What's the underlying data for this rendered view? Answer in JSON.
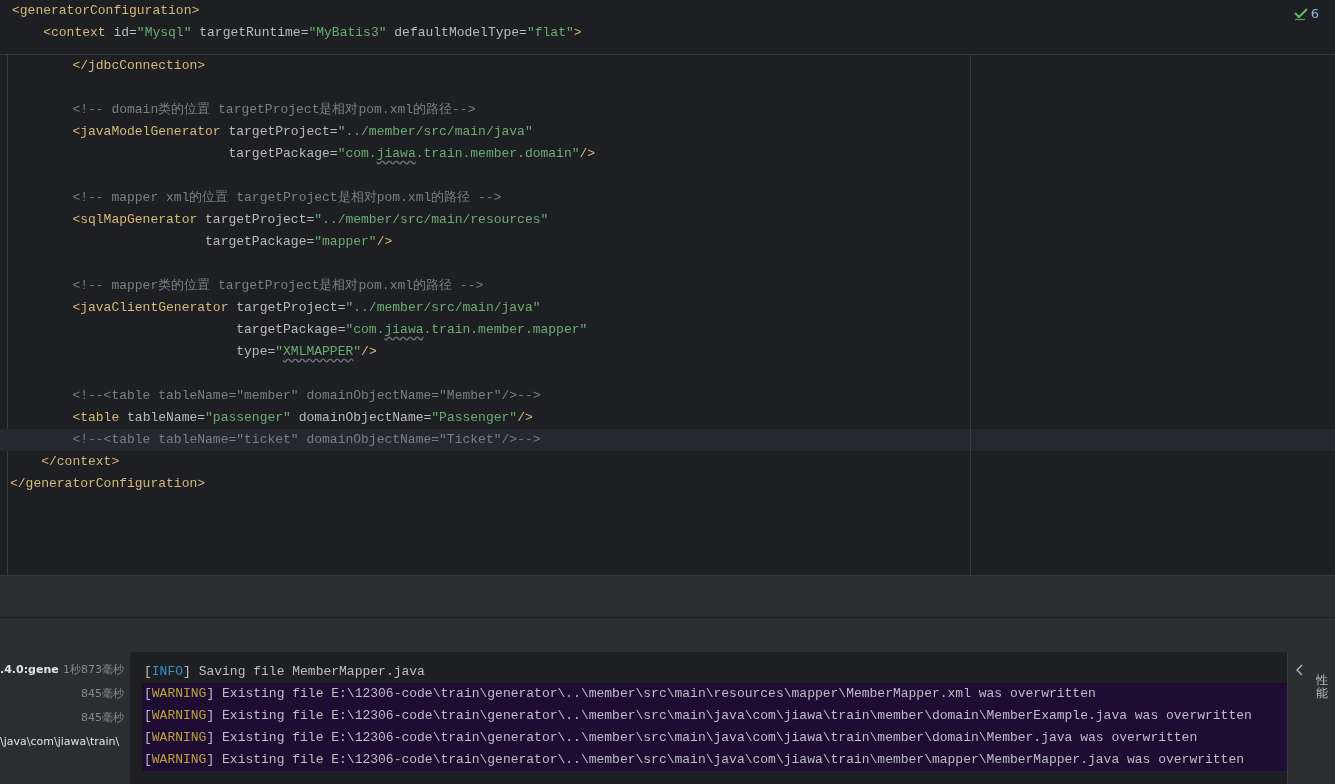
{
  "inspection_widget": {
    "count": "6"
  },
  "sticky_lines": [
    [
      {
        "kind": "tag",
        "text": "<generatorConfiguration>"
      }
    ],
    [
      {
        "kind": "tag",
        "text": "    <context "
      },
      {
        "kind": "attr",
        "text": "id="
      },
      {
        "kind": "value",
        "text": "\"Mysql\""
      },
      {
        "kind": "attr",
        "text": " targetRuntime="
      },
      {
        "kind": "value",
        "text": "\"MyBatis3\""
      },
      {
        "kind": "attr",
        "text": " defaultModelType="
      },
      {
        "kind": "value",
        "text": "\"flat\""
      },
      {
        "kind": "tag",
        "text": ">"
      }
    ]
  ],
  "code_lines": [
    {
      "current": false,
      "segments": [
        {
          "kind": "tag",
          "text": "        </jdbcConnection>"
        }
      ]
    },
    {
      "current": false
    },
    {
      "current": false,
      "segments": [
        {
          "kind": "comment",
          "text": "        <!-- domain类的位置 targetProject是相对pom.xml的路径-->"
        }
      ]
    },
    {
      "current": false,
      "segments": [
        {
          "kind": "tag",
          "text": "        <javaModelGenerator "
        },
        {
          "kind": "attr",
          "text": "targetProject="
        },
        {
          "kind": "value",
          "text": "\"../member/src/main/java\""
        }
      ]
    },
    {
      "current": false,
      "segments": [
        {
          "kind": "attr",
          "text": "                            targetPackage="
        },
        {
          "kind": "value",
          "text": "\"com."
        },
        {
          "kind": "typo",
          "text": "jiawa"
        },
        {
          "kind": "value",
          "text": ".train.member.domain\""
        },
        {
          "kind": "tag",
          "text": "/>"
        }
      ]
    },
    {
      "current": false
    },
    {
      "current": false,
      "segments": [
        {
          "kind": "comment",
          "text": "        <!-- mapper xml的位置 targetProject是相对pom.xml的路径 -->"
        }
      ]
    },
    {
      "current": false,
      "segments": [
        {
          "kind": "tag",
          "text": "        <sqlMapGenerator "
        },
        {
          "kind": "attr",
          "text": "targetProject="
        },
        {
          "kind": "value",
          "text": "\"../member/src/main/resources\""
        }
      ]
    },
    {
      "current": false,
      "segments": [
        {
          "kind": "attr",
          "text": "                         targetPackage="
        },
        {
          "kind": "value",
          "text": "\"mapper\""
        },
        {
          "kind": "tag",
          "text": "/>"
        }
      ]
    },
    {
      "current": false
    },
    {
      "current": false,
      "segments": [
        {
          "kind": "comment",
          "text": "        <!-- mapper类的位置 targetProject是相对pom.xml的路径 -->"
        }
      ]
    },
    {
      "current": false,
      "segments": [
        {
          "kind": "tag",
          "text": "        <javaClientGenerator "
        },
        {
          "kind": "attr",
          "text": "targetProject="
        },
        {
          "kind": "value",
          "text": "\"../member/src/main/java\""
        }
      ]
    },
    {
      "current": false,
      "segments": [
        {
          "kind": "attr",
          "text": "                             targetPackage="
        },
        {
          "kind": "value",
          "text": "\"com."
        },
        {
          "kind": "typo",
          "text": "jiawa"
        },
        {
          "kind": "value",
          "text": ".train.member.mapper\""
        }
      ]
    },
    {
      "current": false,
      "segments": [
        {
          "kind": "attr",
          "text": "                             type="
        },
        {
          "kind": "value",
          "text": "\""
        },
        {
          "kind": "typo",
          "text": "XMLMAPPER"
        },
        {
          "kind": "value",
          "text": "\""
        },
        {
          "kind": "tag",
          "text": "/>"
        }
      ]
    },
    {
      "current": false
    },
    {
      "current": false,
      "segments": [
        {
          "kind": "comment",
          "text": "        <!--<table tableName=\"member\" domainObjectName=\"Member\"/>-->"
        }
      ]
    },
    {
      "current": false,
      "segments": [
        {
          "kind": "tag",
          "text": "        <table "
        },
        {
          "kind": "attr",
          "text": "tableName="
        },
        {
          "kind": "value",
          "text": "\"passenger\""
        },
        {
          "kind": "attr",
          "text": " domainObjectName="
        },
        {
          "kind": "value",
          "text": "\"Passenger\""
        },
        {
          "kind": "tag",
          "text": "/>"
        }
      ]
    },
    {
      "current": true,
      "segments": [
        {
          "kind": "comment",
          "text": "        <!--<table tableName=\"ticket\" domainObjectName=\"Ticket\"/>-->"
        }
      ]
    },
    {
      "current": false,
      "segments": [
        {
          "kind": "tag",
          "text": "    </context>"
        }
      ]
    },
    {
      "current": false,
      "segments": [
        {
          "kind": "tag",
          "text": "</generatorConfiguration>"
        }
      ]
    }
  ],
  "run_tree": [
    {
      "label": ".4.0:gene",
      "time": "1秒873毫秒"
    },
    {
      "time": "845毫秒"
    },
    {
      "time": "845毫秒"
    },
    {
      "label": "\\java\\com\\jiawa\\train\\"
    }
  ],
  "console": [
    {
      "kind": "info",
      "open": "[",
      "level": "INFO",
      "close": "]",
      "text": " Saving file MemberMapper.java"
    },
    {
      "kind": "warning",
      "open": "[",
      "level": "WARNING",
      "close": "]",
      "text": " Existing file E:\\12306-code\\train\\generator\\..\\member\\src\\main\\resources\\mapper\\MemberMapper.xml was overwritten"
    },
    {
      "kind": "warning",
      "open": "[",
      "level": "WARNING",
      "close": "]",
      "text": " Existing file E:\\12306-code\\train\\generator\\..\\member\\src\\main\\java\\com\\jiawa\\train\\member\\domain\\MemberExample.java was overwritten"
    },
    {
      "kind": "warning",
      "open": "[",
      "level": "WARNING",
      "close": "]",
      "text": " Existing file E:\\12306-code\\train\\generator\\..\\member\\src\\main\\java\\com\\jiawa\\train\\member\\domain\\Member.java was overwritten"
    },
    {
      "kind": "warning",
      "open": "[",
      "level": "WARNING",
      "close": "]",
      "text": " Existing file E:\\12306-code\\train\\generator\\..\\member\\src\\main\\java\\com\\jiawa\\train\\member\\mapper\\MemberMapper.java was overwritten"
    }
  ],
  "side_tab": {
    "label": "性能"
  }
}
